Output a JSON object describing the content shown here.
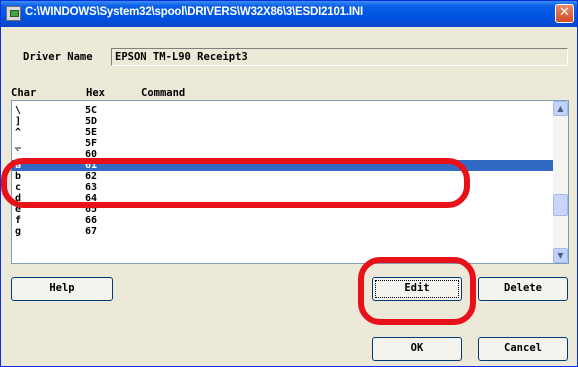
{
  "window": {
    "title": "C:\\WINDOWS\\System32\\spool\\DRIVERS\\W32X86\\3\\ESDI2101.INI"
  },
  "driver": {
    "label": "Driver Name",
    "value": "EPSON TM-L90 Receipt3"
  },
  "columns": {
    "char": "Char",
    "hex": "Hex",
    "command": "Command"
  },
  "rows": [
    {
      "char": "\\",
      "hex": "5C"
    },
    {
      "char": "]",
      "hex": "5D"
    },
    {
      "char": "^",
      "hex": "5E"
    },
    {
      "char": "_",
      "hex": "5F"
    },
    {
      "char": "`",
      "hex": "60"
    },
    {
      "char": "a",
      "hex": "61",
      "selected": true
    },
    {
      "char": "b",
      "hex": "62"
    },
    {
      "char": "c",
      "hex": "63"
    },
    {
      "char": "d",
      "hex": "64"
    },
    {
      "char": "e",
      "hex": "65"
    },
    {
      "char": "f",
      "hex": "66"
    },
    {
      "char": "g",
      "hex": "67"
    }
  ],
  "buttons": {
    "help": "Help",
    "edit": "Edit",
    "delete": "Delete",
    "ok": "OK",
    "cancel": "Cancel"
  },
  "icons": {
    "close": "close-icon",
    "scroll_up": "scroll-up-arrow-icon",
    "scroll_down": "scroll-down-arrow-icon"
  },
  "colors": {
    "selection": "#316ac5",
    "annotation": "#e8111a",
    "titlebar": "#0054e3"
  }
}
